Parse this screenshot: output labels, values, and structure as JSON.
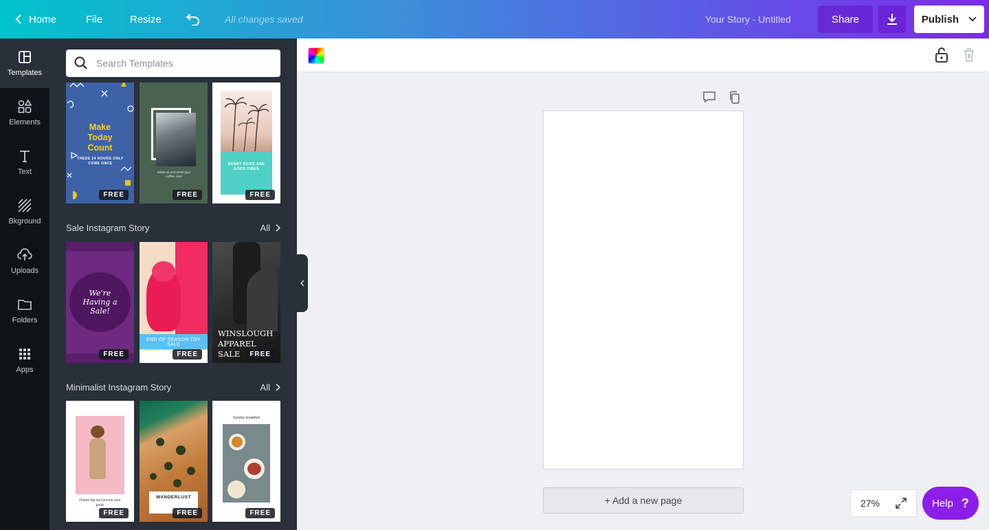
{
  "topbar": {
    "home_label": "Home",
    "file_label": "File",
    "resize_label": "Resize",
    "saved_status": "All changes saved",
    "doc_title": "Your Story - Untitled",
    "share_label": "Share",
    "publish_label": "Publish",
    "gradient_colors": [
      "#00c4cc",
      "#3b8fd9",
      "#5b5ce6",
      "#7d2ae8"
    ]
  },
  "rail": {
    "items": [
      {
        "label": "Templates",
        "icon": "templates-icon"
      },
      {
        "label": "Elements",
        "icon": "elements-icon"
      },
      {
        "label": "Text",
        "icon": "text-icon"
      },
      {
        "label": "Bkground",
        "icon": "background-icon"
      },
      {
        "label": "Uploads",
        "icon": "uploads-icon"
      },
      {
        "label": "Folders",
        "icon": "folders-icon"
      },
      {
        "label": "Apps",
        "icon": "apps-icon"
      }
    ]
  },
  "panel": {
    "search_placeholder": "Search Templates",
    "free_badge": "FREE",
    "all_label": "All",
    "top_row": [
      {
        "line1": "Make",
        "line2": "Today",
        "line3": "Count",
        "sub": "THESE 24 HOURS ONLY COME ONCE"
      },
      {
        "caption": "Wake up and smell your coffee, cool"
      },
      {
        "caption": "SUNNY SKIES AND GOOD VIBES"
      }
    ],
    "sections": [
      {
        "title": "Sale Instagram Story",
        "thumbs": [
          {
            "text": "We're Having a Sale!"
          },
          {
            "text": "END OF SEASON TOY SALE"
          },
          {
            "text": "WINSLOUGH APPAREL SALE"
          }
        ]
      },
      {
        "title": "Minimalist Instagram Story",
        "thumbs": [
          {
            "text": "Dream big and pursue your goals"
          },
          {
            "text": "WANDERLUST"
          },
          {
            "text": "Sunday breakfast"
          }
        ]
      }
    ]
  },
  "editor": {
    "add_page_label": "+ Add a new page",
    "zoom_level": "27%",
    "help_label": "Help",
    "help_icon": "?"
  }
}
